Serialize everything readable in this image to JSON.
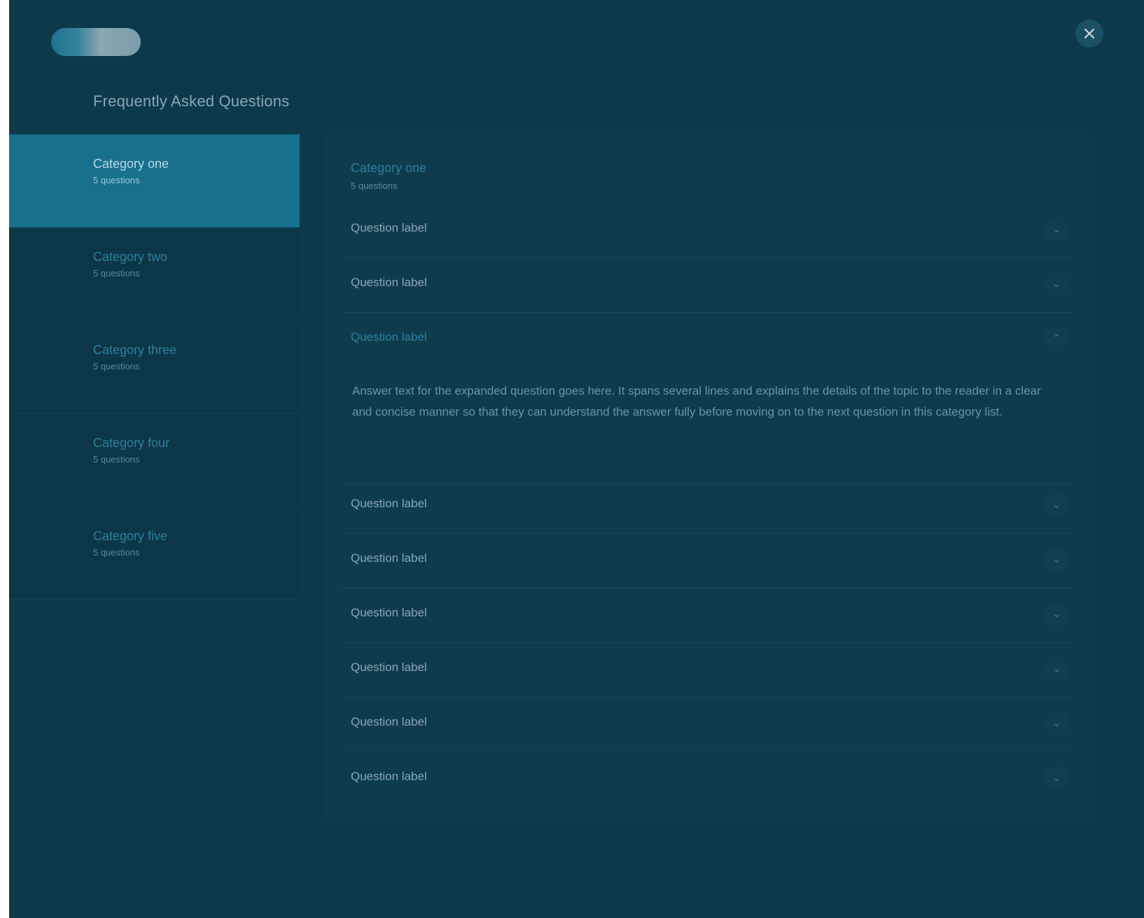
{
  "app": {
    "logo_label": "",
    "close_label": "×",
    "page_title": "Frequently Asked Questions"
  },
  "sidebar": {
    "items": [
      {
        "name": "Category one",
        "sub": "5 questions"
      },
      {
        "name": "Category two",
        "sub": "5 questions"
      },
      {
        "name": "Category three",
        "sub": "5 questions"
      },
      {
        "name": "Category four",
        "sub": "5 questions"
      },
      {
        "name": "Category five",
        "sub": "5 questions"
      }
    ],
    "active_index": 0
  },
  "content": {
    "section_title": "Category one",
    "section_sub": "5 questions",
    "questions": [
      {
        "label": "Question label"
      },
      {
        "label": "Question label"
      },
      {
        "label": "Question label",
        "expanded": true
      },
      {
        "label": "Question label"
      },
      {
        "label": "Question label"
      },
      {
        "label": "Question label"
      },
      {
        "label": "Question label"
      },
      {
        "label": "Question label"
      },
      {
        "label": "Question label"
      }
    ],
    "answer_text": "Answer text for the expanded question goes here. It spans several lines and explains the details of the topic to the reader in a clear and concise manner so that they can understand the answer fully before moving on to the next question in this category list.",
    "chevron_icon": "chevron-down-icon"
  },
  "colors": {
    "background": "#0d3a4b",
    "active": "#17708e",
    "accent_text": "#2d7f9d"
  }
}
